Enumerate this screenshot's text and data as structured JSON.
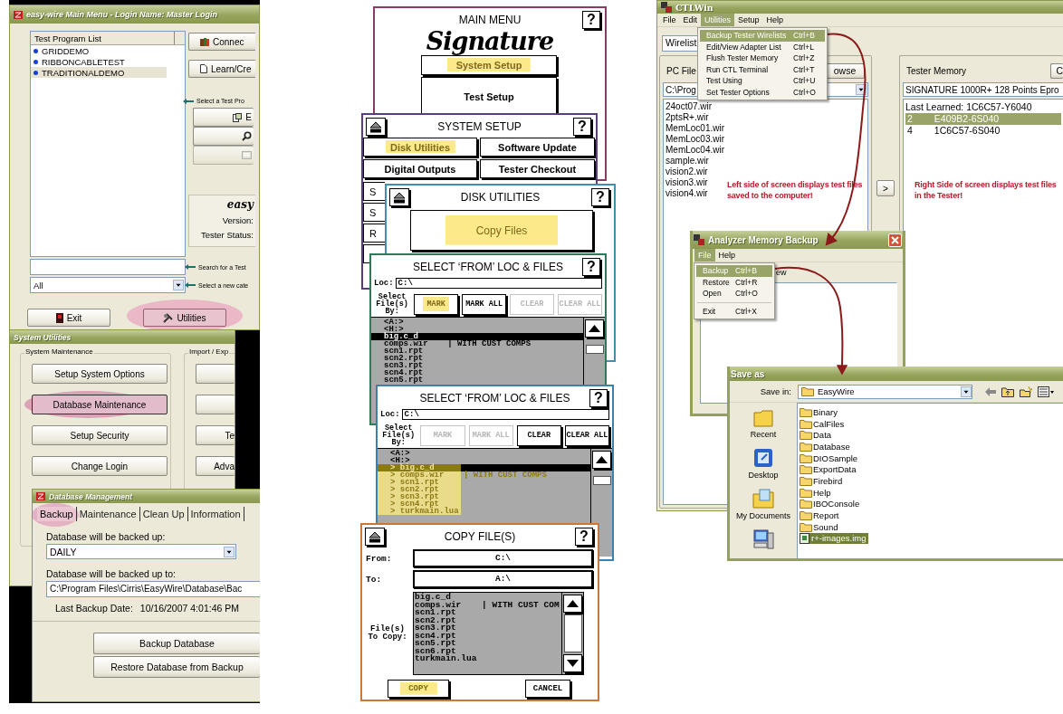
{
  "easywire_main": {
    "title": "easy-wire Main Menu - Login Name: Master Login",
    "list_header": "Test Program List",
    "programs": [
      {
        "name": "GRIDDEMO",
        "selected": false
      },
      {
        "name": "RIBBONCABLETEST",
        "selected": false
      },
      {
        "name": "TRADITIONALDEMO",
        "selected": true
      }
    ],
    "side_buttons": [
      "Connec",
      "Learn/Cre"
    ],
    "hints": [
      "Select a Test Pro",
      "Search for a Test",
      "Select a new cate"
    ],
    "tool_buttons": [
      {
        "label": "E",
        "disabled": false
      },
      {
        "disabled": false
      },
      {
        "disabled": true
      }
    ],
    "info": {
      "brand": "easy",
      "version_label": "Version:",
      "status_label": "Tester Status:"
    },
    "category": "All",
    "buttons": [
      {
        "label": "Exit",
        "highlighted": false
      },
      {
        "label": "Utilities",
        "highlighted": true
      }
    ]
  },
  "system_utilities": {
    "title": "System Utilities",
    "groups": [
      {
        "label": "System Maintenance",
        "buttons": [
          {
            "label": "Setup System Options",
            "highlighted": false
          },
          {
            "label": "Database Maintenance",
            "highlighted": true
          },
          {
            "label": "Setup Security",
            "highlighted": false
          },
          {
            "label": "Change Login",
            "highlighted": false
          }
        ]
      },
      {
        "label": "Import / Exp",
        "buttons": [
          {
            "kind": "blank"
          },
          {
            "kind": "blank"
          },
          {
            "kind": "text",
            "label": "Te"
          },
          {
            "kind": "text",
            "label": "Adva"
          }
        ]
      }
    ]
  },
  "database_management": {
    "title": "Database Management",
    "tabs": [
      {
        "label": "Backup",
        "selected": true,
        "highlighted": true
      },
      {
        "label": "Maintenance",
        "selected": false,
        "highlighted": false
      },
      {
        "label": "Clean Up",
        "selected": false,
        "highlighted": false
      },
      {
        "label": "Information",
        "selected": false,
        "highlighted": false
      }
    ],
    "schedule_label": "Database will be backed up:",
    "schedule": "DAILY",
    "path_label": "Database will be backed up to:",
    "path": "C:\\Program Files\\Cirris\\EasyWire\\Database\\Bac",
    "last_backup_label": "Last Backup Date:",
    "last_backup": "10/16/2007 4:01:46 PM",
    "buttons": [
      "Backup Database",
      "Restore Database from Backup"
    ]
  },
  "touch_panels": [
    {
      "kind": "main_menu",
      "color": "#8b3a62",
      "title": "MAIN MENU",
      "help": "?",
      "logo": "Signature",
      "buttons": [
        {
          "label": "System Setup",
          "highlighted": true
        },
        {
          "label": "Test Setup",
          "highlighted": false
        }
      ]
    },
    {
      "kind": "grid",
      "color": "#5b3d7a",
      "title": "SYSTEM SETUP",
      "help": "?",
      "buttons": [
        {
          "label": "Disk Utilities",
          "highlighted": true
        },
        {
          "label": "Software Update",
          "highlighted": false
        },
        {
          "label": "Digital Outputs",
          "highlighted": false
        },
        {
          "label": "Tester Checkout",
          "highlighted": false
        }
      ],
      "partial_buttons": [
        "S",
        "S",
        "R"
      ]
    },
    {
      "kind": "single",
      "color": "#3f8fb5",
      "title": "DISK UTILITIES",
      "help": "?",
      "buttons": [
        {
          "label": "Copy Files",
          "highlighted": true
        }
      ]
    },
    {
      "kind": "select",
      "color": "#2f7a5a",
      "title": "SELECT ‘FROM’ LOC & FILES",
      "help": "?",
      "loc_label": "Loc:",
      "loc": "C:\\",
      "by_label": "Select File(s) By:",
      "buttons": [
        {
          "label": "MARK",
          "disabled": false,
          "highlighted": true
        },
        {
          "label": "MARK ALL",
          "disabled": false,
          "highlighted": false
        },
        {
          "label": "CLEAR",
          "disabled": true,
          "highlighted": false
        },
        {
          "label": "CLEAR ALL",
          "disabled": true,
          "highlighted": false
        }
      ],
      "files": [
        {
          "name": "<A:>",
          "selected": false,
          "highlighted": false
        },
        {
          "name": "<H:>",
          "selected": false,
          "highlighted": false
        },
        {
          "name": "big.c_d",
          "selected": true,
          "highlighted": false
        },
        {
          "name": "comps.wir    | WITH CUST COMPS",
          "selected": false,
          "highlighted": false
        },
        {
          "name": "scn1.rpt",
          "selected": false,
          "highlighted": false
        },
        {
          "name": "scn2.rpt",
          "selected": false,
          "highlighted": false
        },
        {
          "name": "scn3.rpt",
          "selected": false,
          "highlighted": false
        },
        {
          "name": "scn4.rpt",
          "selected": false,
          "highlighted": false
        },
        {
          "name": "scn5.rpt",
          "selected": false,
          "highlighted": false
        }
      ]
    },
    {
      "kind": "select",
      "color": "#3a82ad",
      "title": "SELECT ‘FROM’ LOC & FILES",
      "help": "?",
      "loc_label": "Loc:",
      "loc": "C:\\",
      "by_label": "Select File(s) By:",
      "buttons": [
        {
          "label": "MARK",
          "disabled": true,
          "highlighted": false
        },
        {
          "label": "MARK ALL",
          "disabled": true,
          "highlighted": false
        },
        {
          "label": "CLEAR",
          "disabled": false,
          "highlighted": false
        },
        {
          "label": "CLEAR ALL",
          "disabled": false,
          "highlighted": false
        }
      ],
      "files": [
        {
          "name": "<A:>",
          "selected": false,
          "highlighted": false
        },
        {
          "name": "<H:>",
          "selected": false,
          "highlighted": false
        },
        {
          "name": "> big.c_d",
          "selected": true,
          "highlighted": true
        },
        {
          "name": "> comps.wir    | WITH CUST COMPS",
          "selected": false,
          "highlighted": true
        },
        {
          "name": "> scn1.rpt",
          "selected": false,
          "highlighted": true
        },
        {
          "name": "> scn2.rpt",
          "selected": false,
          "highlighted": true
        },
        {
          "name": "> scn3.rpt",
          "selected": false,
          "highlighted": true
        },
        {
          "name": "> scn4.rpt",
          "selected": false,
          "highlighted": true
        },
        {
          "name": "> turkmain.lua",
          "selected": false,
          "highlighted": true
        }
      ]
    },
    {
      "kind": "copy",
      "color": "#c8783a",
      "title": "COPY FILE(S)",
      "help": "?",
      "from_label": "From:",
      "from": "C:\\",
      "to_label": "To:",
      "to": "A:\\",
      "files_label": "File(s) To Copy:",
      "files": [
        "big.c_d",
        "comps.wir    | WITH CUST COM",
        "scn1.rpt",
        "scn2.rpt",
        "scn3.rpt",
        "scn4.rpt",
        "scn5.rpt",
        "scn6.rpt",
        "turkmain.lua"
      ],
      "buttons": [
        {
          "label": "COPY",
          "highlighted": true
        },
        {
          "label": "CANCEL",
          "highlighted": false
        }
      ]
    }
  ],
  "ctlwin": {
    "title": "CTLWin",
    "menu": [
      {
        "label": "File",
        "selected": false
      },
      {
        "label": "Edit",
        "selected": false
      },
      {
        "label": "Utilities",
        "selected": true
      },
      {
        "label": "Setup",
        "selected": false
      },
      {
        "label": "Help",
        "selected": false
      }
    ],
    "menu_items": [
      {
        "label": "Backup Tester Wirelists",
        "shortcut": "Ctrl+B",
        "selected": true
      },
      {
        "label": "Edit/View Adapter List",
        "shortcut": "Ctrl+L",
        "selected": false
      },
      {
        "label": "Flush Tester Memory",
        "shortcut": "Ctrl+Z",
        "selected": false
      },
      {
        "label": "Run CTL Terminal",
        "shortcut": "Ctrl+T",
        "selected": false
      },
      {
        "label": "Test Using",
        "shortcut": "Ctrl+U",
        "selected": false
      },
      {
        "label": "Set Tester Options",
        "shortcut": "Ctrl+O",
        "selected": false
      }
    ],
    "wirelist": "Wirelist",
    "pc_label": "PC File",
    "browse": "owse",
    "pc_path": "C:\\Prog",
    "pc_files": [
      "24oct07.wir",
      "2ptsR+.wir",
      "MemLoc01.wir",
      "MemLoc03.wir",
      "MemLoc04.wir",
      "sample.wir",
      "vision2.wir",
      "vision3.wir",
      "vision4.wir"
    ],
    "left_note": "Left side of screen displays test files saved to the computer!",
    "transfer": ">",
    "tester_label": "Tester Memory",
    "tester_button": "C",
    "tester_model": "SIGNATURE 1000R+ 128 Points Epro",
    "tester_header": "Last Learned: 1C6C57-Y6040",
    "tester_files": [
      {
        "slot": "2",
        "name": "E409B2-6S040",
        "selected": true
      },
      {
        "slot": "4",
        "name": "1C6C57-6S040",
        "selected": false
      }
    ],
    "right_note": "Right Side of screen displays test files in the Tester!"
  },
  "analyzer_backup": {
    "title": "Analyzer Memory Backup",
    "menu": [
      {
        "label": "File",
        "selected": true
      },
      {
        "label": "Help",
        "selected": false
      }
    ],
    "menu_items": [
      {
        "kind": "item",
        "label": "Backup",
        "shortcut": "Ctrl+B",
        "selected": true
      },
      {
        "kind": "item",
        "label": "Restore",
        "shortcut": "Ctrl+R",
        "selected": false
      },
      {
        "kind": "item",
        "label": "Open",
        "shortcut": "Ctrl+O",
        "selected": false
      },
      {
        "kind": "separator"
      },
      {
        "kind": "item",
        "label": "Exit",
        "shortcut": "Ctrl+X",
        "selected": false
      }
    ],
    "fragment": "ew"
  },
  "save_as": {
    "title": "Save as",
    "save_in_label": "Save in:",
    "folder": "EasyWire",
    "places": [
      {
        "kind": "recent",
        "label": "Recent"
      },
      {
        "kind": "desktop",
        "label": "Desktop"
      },
      {
        "kind": "documents",
        "label": "My Documents"
      },
      {
        "kind": "computer"
      }
    ],
    "items": [
      {
        "kind": "folder",
        "name": "Binary",
        "selected": false
      },
      {
        "kind": "folder",
        "name": "CalFiles",
        "selected": false
      },
      {
        "kind": "folder",
        "name": "Data",
        "selected": false
      },
      {
        "kind": "folder",
        "name": "Database",
        "selected": false
      },
      {
        "kind": "folder",
        "name": "DIOSample",
        "selected": false
      },
      {
        "kind": "folder",
        "name": "ExportData",
        "selected": false
      },
      {
        "kind": "folder",
        "name": "Firebird",
        "selected": false
      },
      {
        "kind": "folder",
        "name": "Help",
        "selected": false
      },
      {
        "kind": "folder",
        "name": "IBOConsole",
        "selected": false
      },
      {
        "kind": "folder",
        "name": "Report",
        "selected": false
      },
      {
        "kind": "folder",
        "name": "Sound",
        "selected": false
      },
      {
        "kind": "file",
        "name": "r+-images.img",
        "selected": true
      }
    ]
  }
}
